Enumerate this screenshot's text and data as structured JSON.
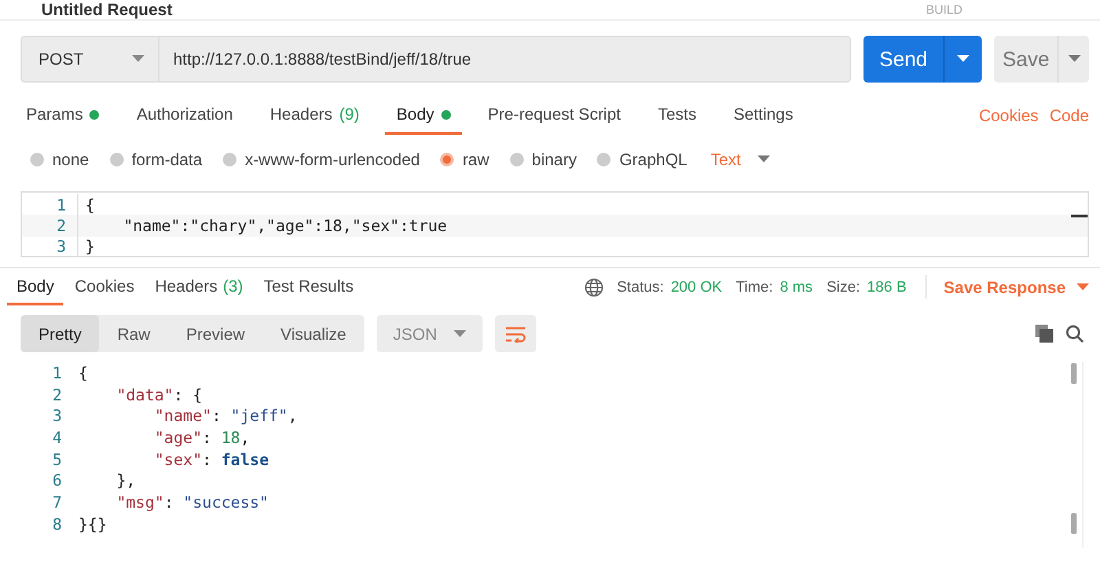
{
  "header": {
    "title": "Untitled Request",
    "build": "BUILD"
  },
  "request": {
    "method": "POST",
    "url": "http://127.0.0.1:8888/testBind/jeff/18/true",
    "send": "Send",
    "save": "Save"
  },
  "request_tabs": [
    {
      "label": "Params",
      "dot": true,
      "selected": false
    },
    {
      "label": "Authorization",
      "dot": false,
      "selected": false
    },
    {
      "label": "Headers",
      "count": "(9)",
      "dot": false,
      "selected": false
    },
    {
      "label": "Body",
      "dot": true,
      "selected": true
    },
    {
      "label": "Pre-request Script",
      "dot": false,
      "selected": false
    },
    {
      "label": "Tests",
      "dot": false,
      "selected": false
    },
    {
      "label": "Settings",
      "dot": false,
      "selected": false
    }
  ],
  "links": [
    "Cookies",
    "Code"
  ],
  "body_types": [
    {
      "label": "none",
      "selected": false
    },
    {
      "label": "form-data",
      "selected": false
    },
    {
      "label": "x-www-form-urlencoded",
      "selected": false
    },
    {
      "label": "raw",
      "selected": true
    },
    {
      "label": "binary",
      "selected": false
    },
    {
      "label": "GraphQL",
      "selected": false
    }
  ],
  "body_format": "Text",
  "request_body": [
    {
      "number": "1",
      "text": "{"
    },
    {
      "number": "2",
      "text": "    \"name\":\"chary\",\"age\":18,\"sex\":true"
    },
    {
      "number": "3",
      "text": "}"
    }
  ],
  "response_tabs": [
    {
      "label": "Body",
      "selected": true
    },
    {
      "label": "Cookies",
      "selected": false
    },
    {
      "label": "Headers",
      "count": "(3)",
      "selected": false
    },
    {
      "label": "Test Results",
      "selected": false
    }
  ],
  "status": {
    "status_label": "Status:",
    "status": "200 OK",
    "time_label": "Time:",
    "time": "8 ms",
    "size_label": "Size:",
    "size": "186 B",
    "save_response": "Save Response"
  },
  "view_modes": [
    {
      "label": "Pretty",
      "selected": true
    },
    {
      "label": "Raw",
      "selected": false
    },
    {
      "label": "Preview",
      "selected": false
    },
    {
      "label": "Visualize",
      "selected": false
    }
  ],
  "response_format": "JSON",
  "response_body": [
    {
      "number": "1",
      "tokens": [
        {
          "kind": "punct",
          "text": "{"
        }
      ]
    },
    {
      "number": "2",
      "tokens": [
        {
          "kind": "key",
          "text": "    \"data\""
        },
        {
          "kind": "punct",
          "text": ": {"
        }
      ]
    },
    {
      "number": "3",
      "tokens": [
        {
          "kind": "key",
          "text": "        \"name\""
        },
        {
          "kind": "punct",
          "text": ": "
        },
        {
          "kind": "string",
          "text": "\"jeff\""
        },
        {
          "kind": "punct",
          "text": ","
        }
      ]
    },
    {
      "number": "4",
      "tokens": [
        {
          "kind": "key",
          "text": "        \"age\""
        },
        {
          "kind": "punct",
          "text": ": "
        },
        {
          "kind": "number",
          "text": "18"
        },
        {
          "kind": "punct",
          "text": ","
        }
      ]
    },
    {
      "number": "5",
      "tokens": [
        {
          "kind": "key",
          "text": "        \"sex\""
        },
        {
          "kind": "punct",
          "text": ": "
        },
        {
          "kind": "boolean",
          "text": "false"
        }
      ]
    },
    {
      "number": "6",
      "tokens": [
        {
          "kind": "punct",
          "text": "    },"
        }
      ]
    },
    {
      "number": "7",
      "tokens": [
        {
          "kind": "key",
          "text": "    \"msg\""
        },
        {
          "kind": "punct",
          "text": ": "
        },
        {
          "kind": "string",
          "text": "\"success\""
        }
      ]
    },
    {
      "number": "8",
      "tokens": [
        {
          "kind": "punct",
          "text": "}{}"
        }
      ]
    }
  ]
}
